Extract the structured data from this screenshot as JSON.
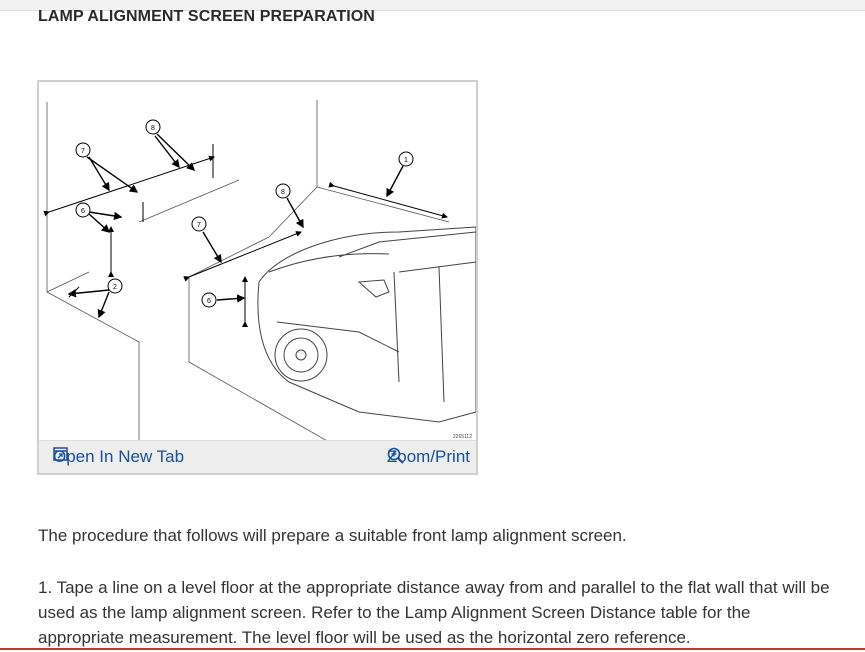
{
  "page": {
    "title": "LAMP ALIGNMENT SCREEN PREPARATION"
  },
  "figure": {
    "image_code": "2265112",
    "callouts": [
      "1",
      "2",
      "6",
      "6",
      "7",
      "7",
      "8",
      "8"
    ],
    "open_label": "Open In New Tab",
    "zoom_label": "Zoom/Print",
    "open_icon": "open-in-new-tab-icon",
    "zoom_icon": "zoom-in-icon"
  },
  "content": {
    "intro": "The procedure that follows will prepare a suitable front lamp alignment screen.",
    "step1": "1. Tape a line on a level floor at the appropriate distance away from and parallel to the flat wall that will be used as the lamp alignment screen. Refer to the Lamp Alignment Screen Distance table for the appropriate measurement. The level floor will be used as the horizontal zero reference."
  },
  "colors": {
    "link": "#1a4f9c",
    "text": "#333333",
    "accent": "#c0392b"
  }
}
